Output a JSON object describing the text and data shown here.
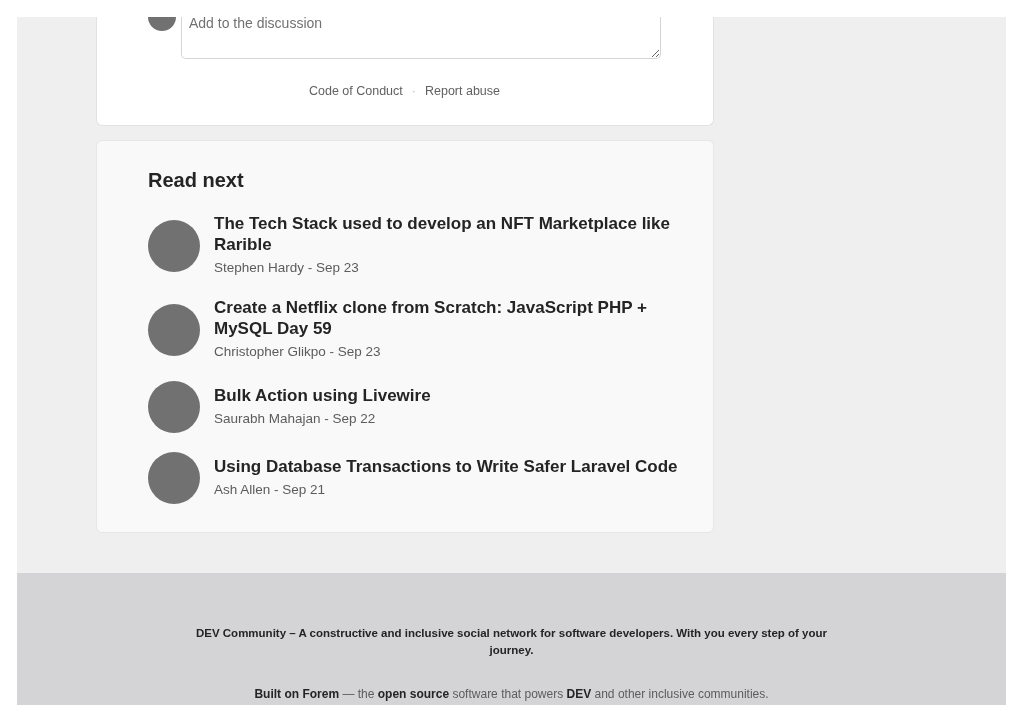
{
  "comment_box": {
    "placeholder": "Add to the discussion",
    "links": [
      "Code of Conduct",
      "Report abuse"
    ],
    "separator": "·"
  },
  "read_next": {
    "title": "Read next",
    "articles": [
      {
        "title": "The Tech Stack used to develop an NFT Marketplace like Rarible",
        "meta": "Stephen Hardy - Sep 23"
      },
      {
        "title": "Create a Netflix clone from Scratch: JavaScript PHP + MySQL Day 59",
        "meta": "Christopher Glikpo - Sep 23"
      },
      {
        "title": "Bulk Action using Livewire",
        "meta": "Saurabh Mahajan - Sep 22"
      },
      {
        "title": "Using Database Transactions to Write Safer Laravel Code",
        "meta": "Ash Allen - Sep 21"
      }
    ]
  },
  "footer": {
    "tagline": "DEV Community – A constructive and inclusive social network for software developers. With you every step of your journey.",
    "credit": [
      {
        "kind": "link",
        "text": "Built on Forem"
      },
      {
        "kind": "text",
        "text": " — the "
      },
      {
        "kind": "link",
        "text": "open source"
      },
      {
        "kind": "text",
        "text": " software that powers "
      },
      {
        "kind": "link",
        "text": "DEV"
      },
      {
        "kind": "text",
        "text": " and other inclusive communities."
      }
    ]
  }
}
